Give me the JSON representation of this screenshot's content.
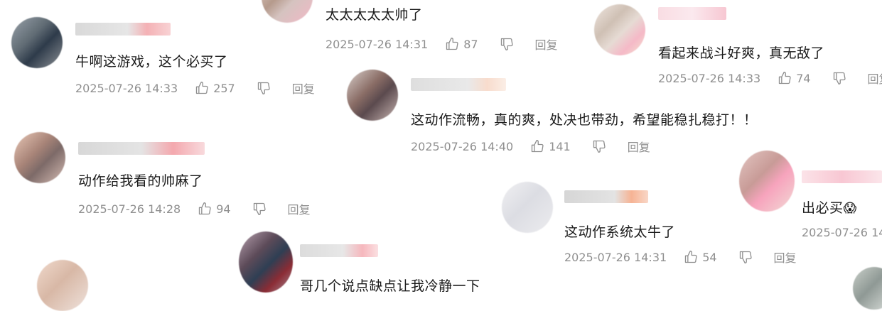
{
  "comments": [
    {
      "text": "太太太太太帅了",
      "time": "2025-07-26 14:31",
      "likes": "87",
      "reply": "回复"
    },
    {
      "text": "看起来战斗好爽，真无敌了",
      "time": "2025-07-26 14:33",
      "likes": "74",
      "reply": "回复"
    },
    {
      "text": "牛啊这游戏，这个必买了",
      "time": "2025-07-26 14:33",
      "likes": "257",
      "reply": "回复"
    },
    {
      "text": "这动作流畅，真的爽，处决也带劲，希望能稳扎稳打！！",
      "time": "2025-07-26 14:40",
      "likes": "141",
      "reply": "回复"
    },
    {
      "text": "动作给我看的帅麻了",
      "time": "2025-07-26 14:28",
      "likes": "94",
      "reply": "回复"
    },
    {
      "text": "出必买",
      "emoji": "😱",
      "time": "2025-07-26 14",
      "likes": "",
      "reply": ""
    },
    {
      "text": "这动作系统太牛了",
      "time": "2025-07-26 14:31",
      "likes": "54",
      "reply": "回复"
    },
    {
      "text": "哥几个说点缺点让我冷静一下",
      "time": "",
      "likes": "",
      "reply": ""
    }
  ],
  "colors": {
    "text": "#1a1a1a",
    "meta": "#8f8f8f",
    "pink": "#f7a7ad"
  },
  "icons": {
    "like": "thumbs-up-icon",
    "dislike": "thumbs-down-icon"
  }
}
